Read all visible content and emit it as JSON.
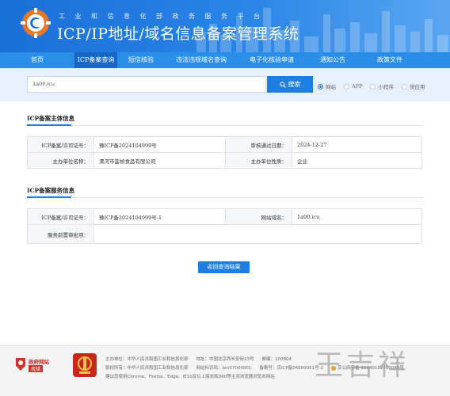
{
  "header": {
    "ministry": "工业和信息化部政务服务平台",
    "title": "ICP/IP地址/域名信息备案管理系统",
    "brand_color": "#1a6fd6"
  },
  "nav": {
    "items": [
      "首页",
      "ICP备案查询",
      "短信核验",
      "违法违规域名查询",
      "电子化核验申请",
      "通知公告",
      "政策文件"
    ],
    "active_index": 1
  },
  "search": {
    "value": "1a00.icu",
    "button_label": "搜索",
    "button_icon": "search-icon",
    "options": [
      "网站",
      "APP",
      "小程序",
      "快应用"
    ],
    "selected_index": 0
  },
  "subject": {
    "title": "ICP备案主体信息",
    "rows": [
      {
        "l1": "ICP备案/许可证号：",
        "v1": "豫ICP备2024104999号",
        "l2": "审核通过日期：",
        "v2": "2024-12-27"
      },
      {
        "l1": "主办单位名称：",
        "v1": "漯河市莚帧食品有限公司",
        "l2": "主办单位性质：",
        "v2": "企业"
      }
    ]
  },
  "service": {
    "title": "ICP备案服务信息",
    "row1": {
      "l1": "ICP备案/许可证号：",
      "v1": "豫ICP备2024104999号-1",
      "l2": "网站域名：",
      "v2": "1a00.icu"
    },
    "row2": {
      "l1": "服务前置审批项：",
      "v1": ""
    }
  },
  "back_button": "返回查询结果",
  "footer": {
    "gov_badge_line1": "政府网站",
    "gov_badge_line2": "找错",
    "line1": [
      "主办单位：中华人民共和国工业和信息化部",
      "地址：中国北京西长安街13号",
      "邮编：100804"
    ],
    "line2": [
      "版权所有：中华人民共和国工业和信息化部",
      "网站标识码：bm07000001",
      "备案号：京ICP备04000001号-2",
      "京公网安备 11040102700068号"
    ],
    "line3": "建议您使用Chrome、Firefox、Edge、IE10及以上版本和360等主流浏览器浏览本网站",
    "watermark": "王吉祥"
  }
}
